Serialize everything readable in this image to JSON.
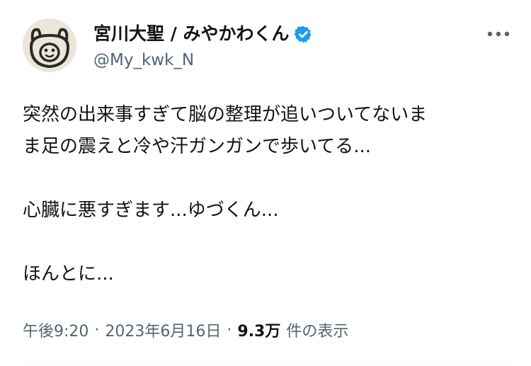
{
  "author": {
    "display_name": "宮川大聖 / みやかわくん",
    "handle": "@My_kwk_N",
    "verified": true,
    "avatar_icon": "avatar-illustration-icon",
    "verified_icon": "verified-badge-icon",
    "verified_color": "#1d9bf0"
  },
  "menu": {
    "more_icon": "more-dots-icon"
  },
  "tweet": {
    "lines": [
      "突然の出来事すぎて脳の整理が追いついてないま",
      "ま足の震えと冷や汗ガンガンで歩いてる...",
      "心臓に悪すぎます...ゆづくん...",
      "ほんとに..."
    ]
  },
  "meta": {
    "time": "午後9:20",
    "separator": "·",
    "date": "2023年6月16日",
    "views_count": "9.3万",
    "views_label": "件の表示"
  },
  "colors": {
    "text_primary": "#0f1419",
    "text_secondary": "#536471",
    "accent": "#1d9bf0",
    "background": "#ffffff"
  }
}
